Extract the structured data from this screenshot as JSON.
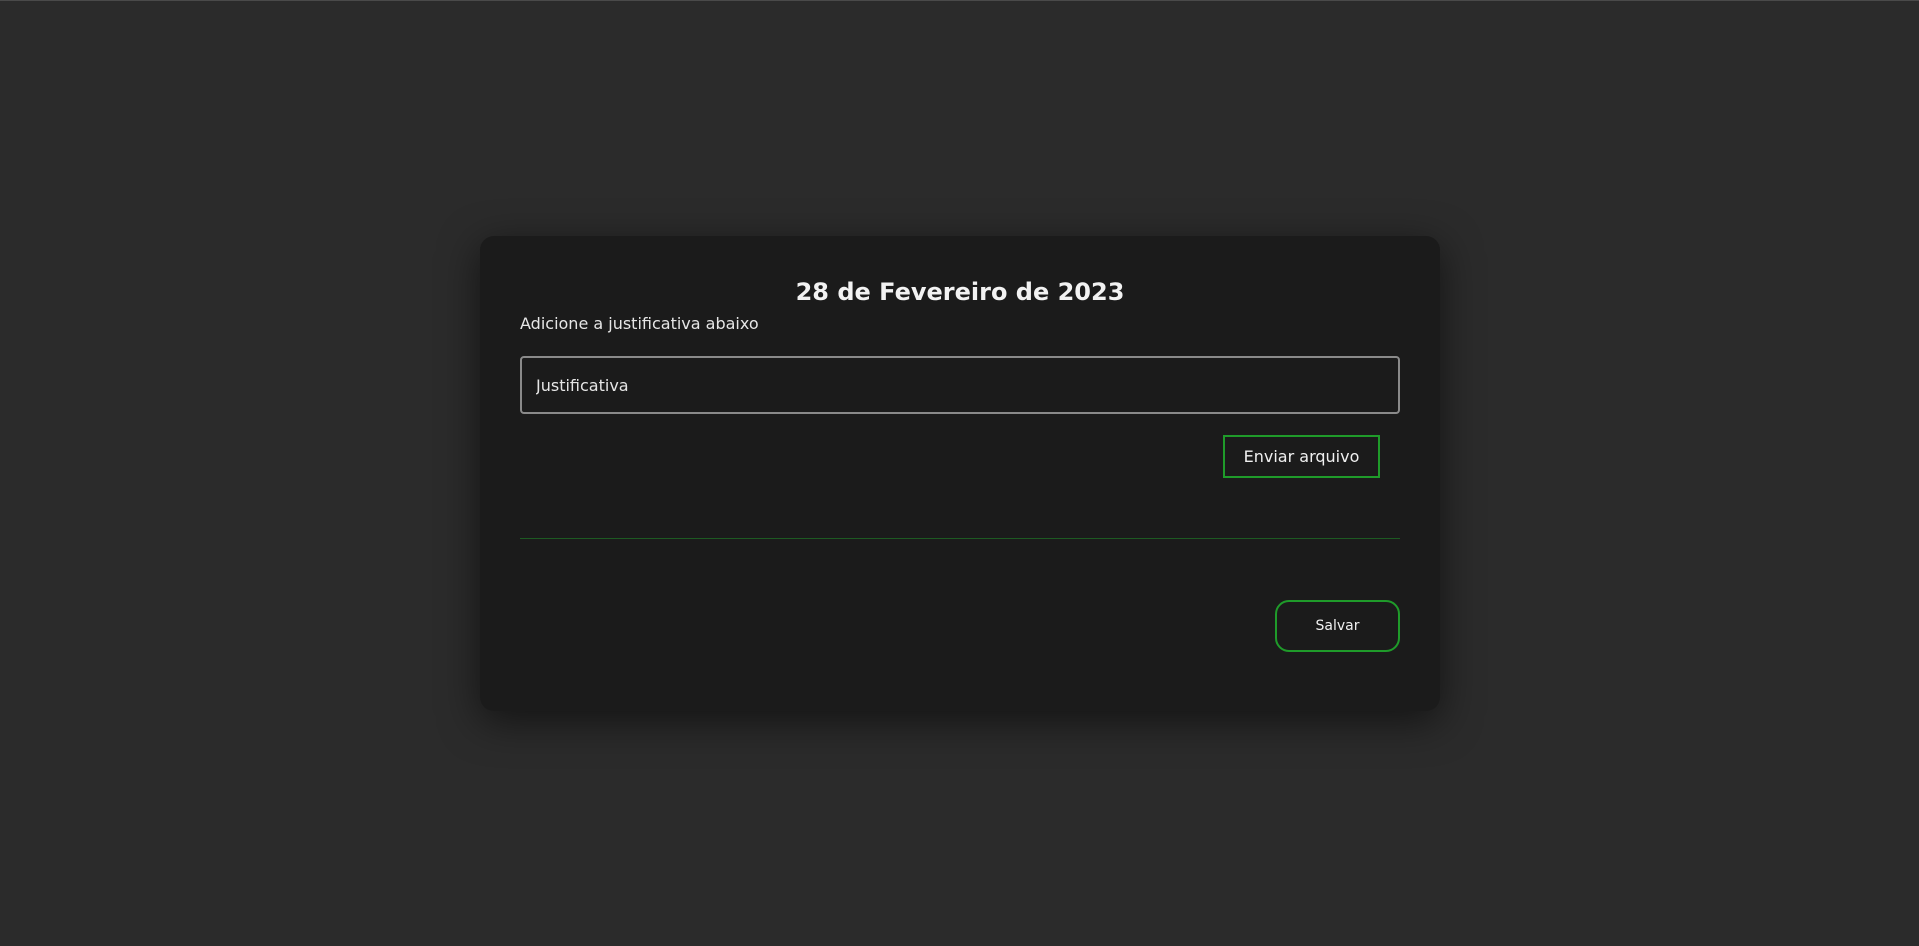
{
  "modal": {
    "title": "28 de Fevereiro de 2023",
    "subtitle": "Adicione a justificativa abaixo",
    "justification_input": {
      "placeholder": "Justificativa",
      "value": ""
    },
    "upload_button_label": "Enviar arquivo",
    "save_button_label": "Salvar"
  },
  "colors": {
    "page_background": "#2b2b2b",
    "modal_background": "#1b1b1b",
    "accent_green": "#1f9b2a",
    "text": "#ececec",
    "input_border": "#8a8a8a"
  }
}
